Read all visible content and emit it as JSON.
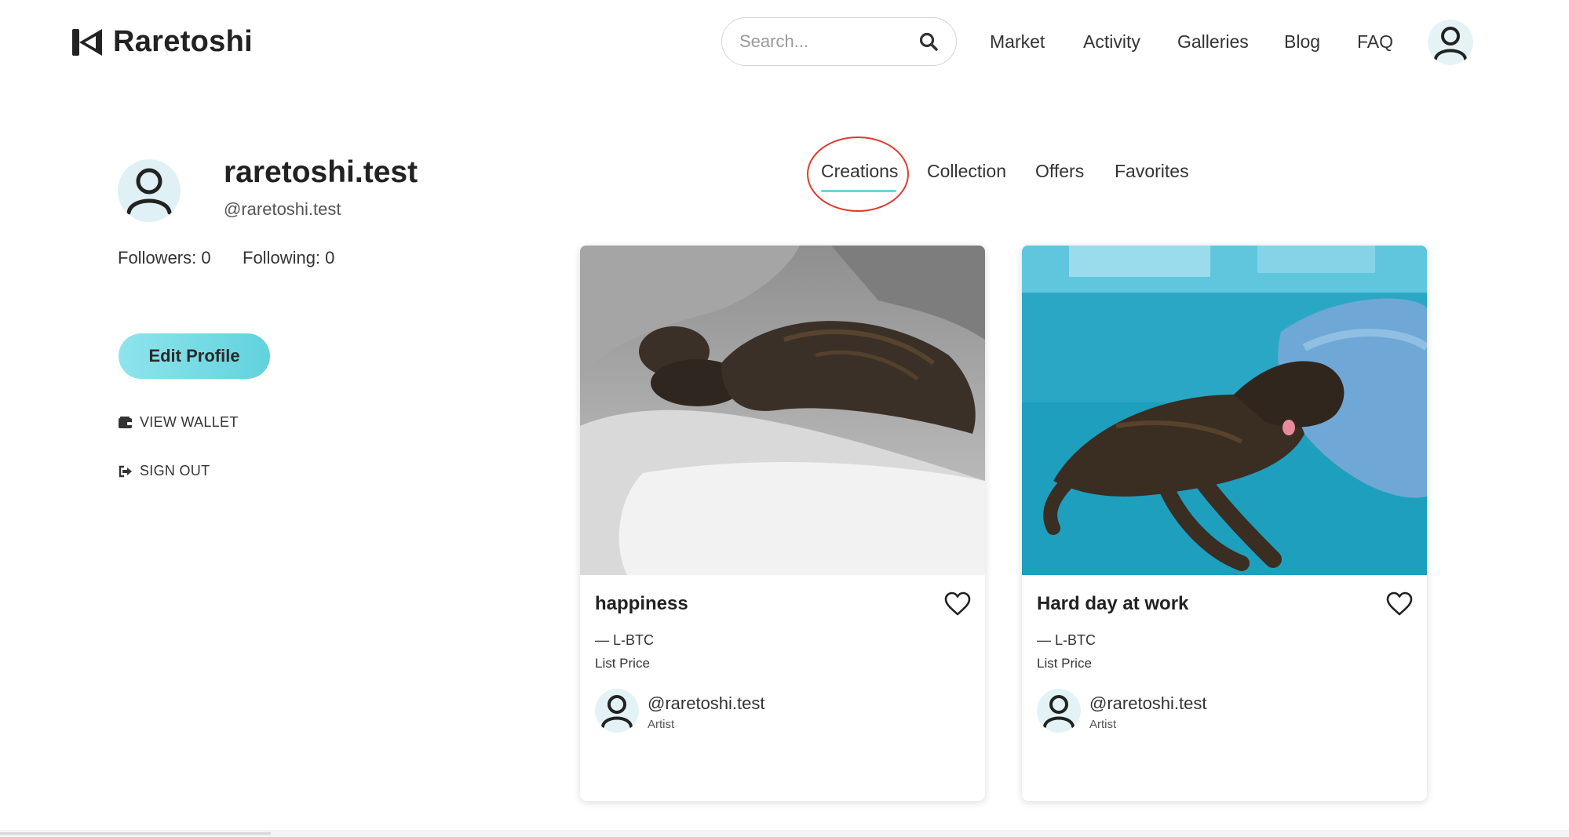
{
  "header": {
    "brand": "Raretoshi",
    "search_placeholder": "Search...",
    "nav": [
      "Market",
      "Activity",
      "Galleries",
      "Blog",
      "FAQ"
    ]
  },
  "profile": {
    "name": "raretoshi.test",
    "handle": "@raretoshi.test",
    "followers": "Followers: 0",
    "following": "Following: 0",
    "edit_label": "Edit Profile",
    "view_wallet": "VIEW WALLET",
    "sign_out": "SIGN OUT"
  },
  "tabs": [
    "Creations",
    "Collection",
    "Offers",
    "Favorites"
  ],
  "active_tab": "Creations",
  "cards": [
    {
      "title": "happiness",
      "price": "— L-BTC",
      "price_label": "List Price",
      "artist": "@raretoshi.test",
      "role": "Artist",
      "image": "dog-sleeping-on-grey-beanbag"
    },
    {
      "title": "Hard day at work",
      "price": "— L-BTC",
      "price_label": "List Price",
      "artist": "@raretoshi.test",
      "role": "Artist",
      "image": "dog-sleeping-on-teal-sofa"
    }
  ],
  "colors": {
    "accent": "#6fd3dd",
    "button": "#74d9e2",
    "highlight_circle": "#e03b2f"
  }
}
